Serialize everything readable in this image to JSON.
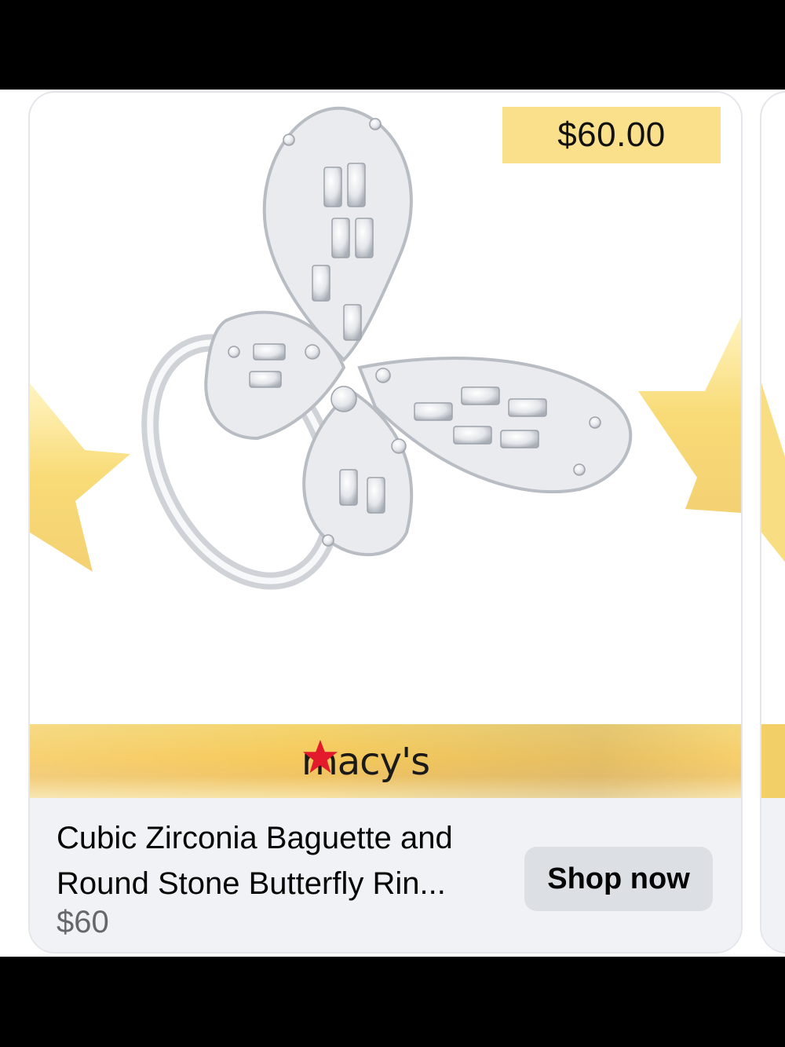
{
  "ad": {
    "price_tag": "$60.00",
    "brand": "macy's",
    "product_title": "Cubic Zirconia Baguette and Round Stone Butterfly Rin...",
    "price": "$60",
    "cta_label": "Shop now"
  },
  "colors": {
    "price_tag_bg": "#fbe08c",
    "brand_star": "#e21a2c",
    "footer_bg": "#f0f2f5",
    "button_bg": "#dcdfe4"
  },
  "icons": [
    "butterfly-ring-image",
    "macys-star-icon",
    "gold-star-decoration"
  ]
}
